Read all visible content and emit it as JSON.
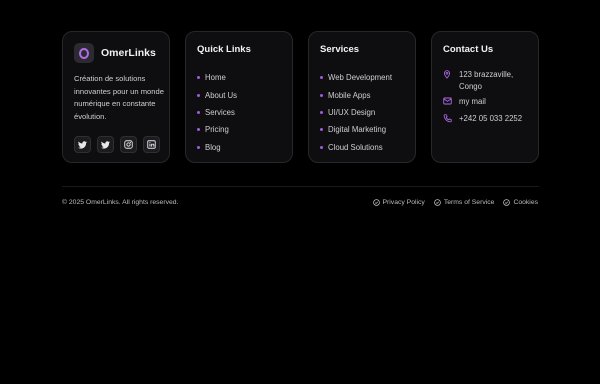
{
  "brand": {
    "name": "OmerLinks",
    "tagline": "Création de solutions innovantes pour un monde numérique en constante évolution.",
    "accent_color": "#b06be8",
    "social_icons": [
      "twitter-icon",
      "twitter-icon",
      "instagram-icon",
      "linkedin-icon"
    ]
  },
  "quick_links": {
    "title": "Quick Links",
    "items": [
      {
        "label": "Home"
      },
      {
        "label": "About Us"
      },
      {
        "label": "Services"
      },
      {
        "label": "Pricing"
      },
      {
        "label": "Blog"
      }
    ]
  },
  "services": {
    "title": "Services",
    "items": [
      {
        "label": "Web Development"
      },
      {
        "label": "Mobile Apps"
      },
      {
        "label": "UI/UX Design"
      },
      {
        "label": "Digital Marketing"
      },
      {
        "label": "Cloud Solutions"
      }
    ]
  },
  "contact": {
    "title": "Contact Us",
    "address": "123 brazzaville, Congo",
    "email": "my mail",
    "phone": "+242 05 033 2252"
  },
  "footer": {
    "copyright": "© 2025 OmerLinks. All rights reserved.",
    "links": [
      {
        "label": "Privacy Policy"
      },
      {
        "label": "Terms of Service"
      },
      {
        "label": "Cookies"
      }
    ]
  }
}
